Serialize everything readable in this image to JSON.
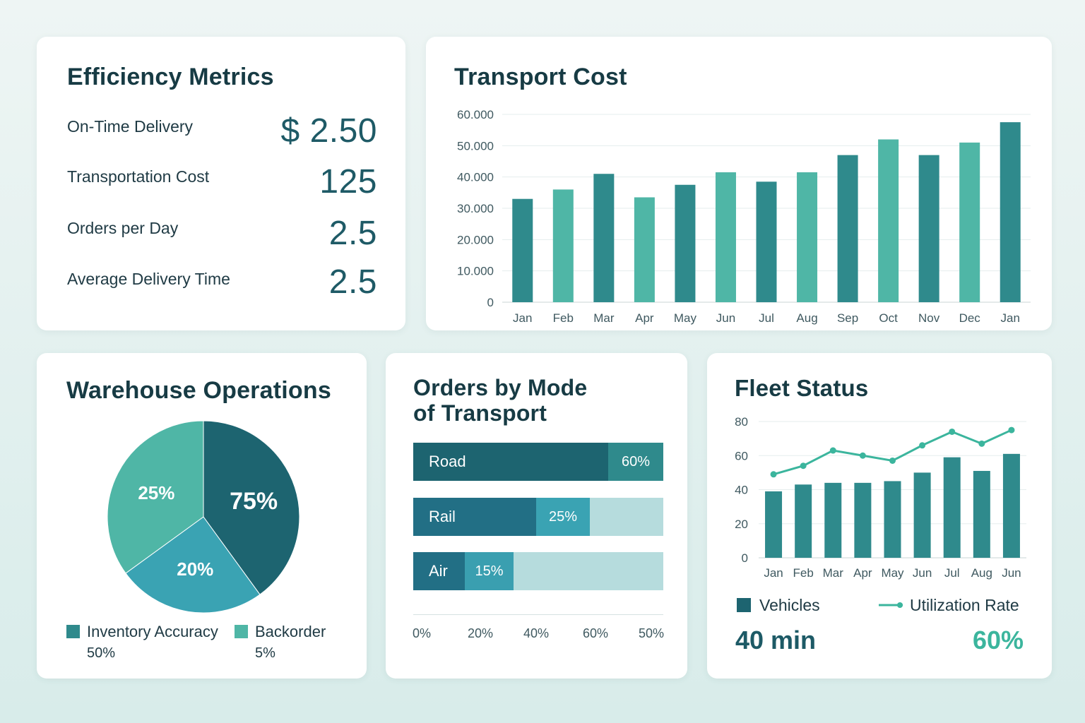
{
  "colors": {
    "dark_teal": "#1d6470",
    "mid_teal": "#2f8a8c",
    "light_teal": "#4fb6a6",
    "cyan_teal": "#3aa3b3",
    "pale": "#b6dcdd",
    "accent_green": "#3bb59d"
  },
  "efficiency": {
    "title": "Efficiency Metrics",
    "metrics": [
      {
        "label": "On-Time Delivery",
        "value": "$ 2.50"
      },
      {
        "label": "Transportation Cost",
        "value": "125"
      },
      {
        "label": "Orders per Day",
        "value": "2.5"
      },
      {
        "label": "Average Delivery Time",
        "value": "2.5"
      }
    ]
  },
  "transport_cost": {
    "title": "Transport Cost"
  },
  "warehouse": {
    "title": "Warehouse Operations",
    "legend": [
      {
        "label": "Inventory Accuracy",
        "value": "50%"
      },
      {
        "label": "Backorder",
        "value": "5%"
      }
    ]
  },
  "orders_by_mode": {
    "title_line1": "Orders by Mode",
    "title_line2": "of Transport",
    "rows": [
      {
        "label": "Road",
        "pct_label": "60%"
      },
      {
        "label": "Rail",
        "pct_label": "25%"
      },
      {
        "label": "Air",
        "pct_label": "15%"
      }
    ],
    "axis_ticks": [
      "0%",
      "20%",
      "40%",
      "60%",
      "50%"
    ]
  },
  "fleet": {
    "title": "Fleet Status",
    "legend_vehicles": "Vehicles",
    "legend_utilization": "Utilization Rate",
    "stat_left": "40 min",
    "stat_right": "60%"
  },
  "chart_data": [
    {
      "type": "bar",
      "title": "Transport Cost",
      "categories": [
        "Jan",
        "Feb",
        "Mar",
        "Apr",
        "May",
        "Jun",
        "Jul",
        "Aug",
        "Sep",
        "Oct",
        "Nov",
        "Dec",
        "Jan"
      ],
      "values": [
        33000,
        36000,
        41000,
        33500,
        37500,
        41500,
        38500,
        41500,
        47000,
        52000,
        47000,
        51000,
        57500
      ],
      "yticks": [
        "0",
        "10.000",
        "20.000",
        "30.000",
        "40.000",
        "50.000",
        "60.000"
      ],
      "ylim": [
        0,
        60000
      ],
      "grid": true
    },
    {
      "type": "pie",
      "title": "Warehouse Operations",
      "slices": [
        {
          "label": "75%",
          "value": 40
        },
        {
          "label": "20%",
          "value": 25
        },
        {
          "label": "25%",
          "value": 35
        }
      ]
    },
    {
      "type": "bar",
      "title": "Orders by Mode of Transport",
      "orientation": "horizontal",
      "categories": [
        "Road",
        "Rail",
        "Air"
      ],
      "values": [
        60,
        25,
        15
      ]
    },
    {
      "type": "bar",
      "title": "Fleet Status",
      "categories": [
        "Jan",
        "Feb",
        "Mar",
        "Apr",
        "May",
        "Jun",
        "Jul",
        "Aug",
        "Jun"
      ],
      "yticks": [
        "0",
        "20",
        "40",
        "60",
        "80"
      ],
      "ylim": [
        0,
        80
      ],
      "series": [
        {
          "name": "Vehicles",
          "type": "bar",
          "values": [
            39,
            43,
            44,
            44,
            45,
            50,
            59,
            51,
            61
          ]
        },
        {
          "name": "Utilization Rate",
          "type": "line",
          "values": [
            49,
            54,
            63,
            60,
            57,
            66,
            74,
            67,
            75
          ]
        }
      ],
      "grid": true
    }
  ]
}
